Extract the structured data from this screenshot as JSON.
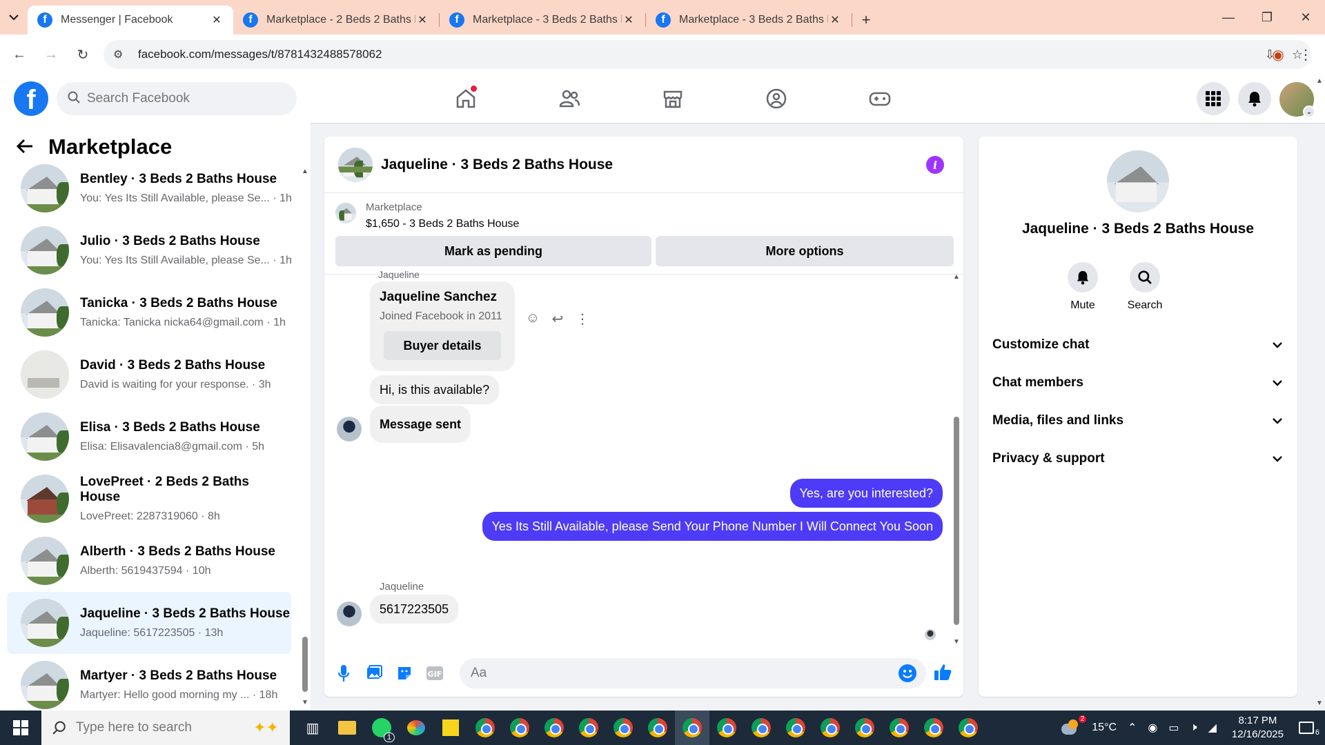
{
  "browser": {
    "tabs": [
      {
        "title": "Messenger | Facebook",
        "active": true
      },
      {
        "title": "Marketplace - 2 Beds 2 Baths H",
        "active": false
      },
      {
        "title": "Marketplace - 3 Beds 2 Baths H",
        "active": false
      },
      {
        "title": "Marketplace - 3 Beds 2 Baths H",
        "active": false
      }
    ],
    "url": "facebook.com/messages/t/8781432488578062"
  },
  "header": {
    "search_placeholder": "Search Facebook"
  },
  "left": {
    "title": "Marketplace",
    "chats": [
      {
        "name": "Bentley · 3 Beds 2 Baths House",
        "snippet": "You: Yes Its Still Available, please Se... · 1h",
        "thumb": "house",
        "selected": false
      },
      {
        "name": "Julio · 3 Beds 2 Baths House",
        "snippet": "You: Yes Its Still Available, please Se... · 1h",
        "thumb": "house",
        "selected": false
      },
      {
        "name": "Tanicka · 3 Beds 2 Baths House",
        "snippet": "Tanicka: Tanicka nicka64@gmail.com · 1h",
        "thumb": "house",
        "selected": false
      },
      {
        "name": "David · 3 Beds 2 Baths House",
        "snippet": "David is waiting for your response. · 3h",
        "thumb": "room",
        "selected": false
      },
      {
        "name": "Elisa · 3 Beds 2 Baths House",
        "snippet": "Elisa: Elisavalencia8@gmail.com · 5h",
        "thumb": "house",
        "selected": false
      },
      {
        "name": "LovePreet · 2 Beds 2 Baths House",
        "snippet": "LovePreet: 2287319060 · 8h",
        "thumb": "brick",
        "selected": false
      },
      {
        "name": "Alberth · 3 Beds 2 Baths House",
        "snippet": "Alberth: 5619437594 · 10h",
        "thumb": "house",
        "selected": false
      },
      {
        "name": "Jaqueline · 3 Beds 2 Baths House",
        "snippet": "Jaqueline: 5617223505 · 13h",
        "thumb": "house",
        "selected": true
      },
      {
        "name": "Martyer · 3 Beds 2 Baths House",
        "snippet": "Martyer: Hello good morning my ... · 18h",
        "thumb": "house",
        "selected": false
      }
    ]
  },
  "conversation": {
    "title": "Jaqueline · 3 Beds 2 Baths House",
    "marketplace_label": "Marketplace",
    "listing": "$1,650 - 3 Beds 2 Baths House",
    "mark_pending": "Mark as pending",
    "more_options": "More options",
    "sender_top": "Jaqueline",
    "card_name": "Jaqueline Sanchez",
    "card_joined": "Joined Facebook in 2011",
    "buyer_details": "Buyer details",
    "msg_available": "Hi, is this available?",
    "msg_sent": "Message sent",
    "out1": "Yes, are you interested?",
    "out2": "Yes Its Still Available, please Send Your Phone Number I Will Connect You Soon",
    "sender_bottom": "Jaqueline",
    "msg_phone": "5617223505",
    "composer_placeholder": "Aa"
  },
  "info": {
    "name": "Jaqueline · 3 Beds 2 Baths House",
    "mute": "Mute",
    "search": "Search",
    "rows": [
      "Customize chat",
      "Chat members",
      "Media, files and links",
      "Privacy & support"
    ]
  },
  "taskbar": {
    "search_placeholder": "Type here to search",
    "weather_badge": "2",
    "temp": "15°C",
    "time": "8:17 PM",
    "date": "12/16/2025",
    "notif_count": "6",
    "whatsapp_badge": "1"
  },
  "colors": {
    "fb_blue": "#1877f2",
    "outgoing_bubble": "#4e3bf7",
    "info_purple": "#a033ff",
    "tab_strip": "#fbd7c8"
  }
}
